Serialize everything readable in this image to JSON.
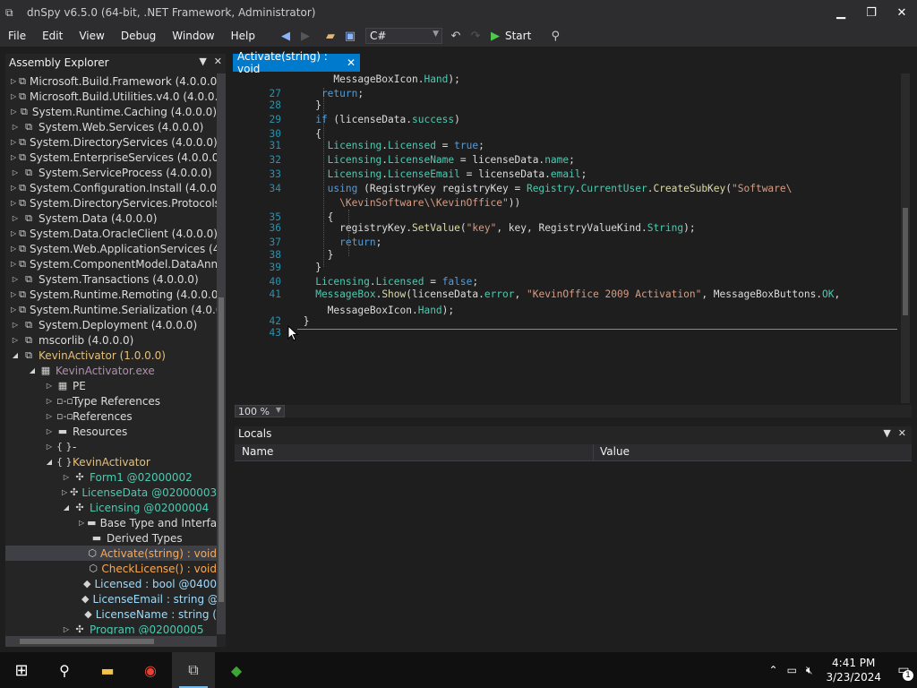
{
  "window": {
    "title": "dnSpy v6.5.0 (64-bit, .NET Framework, Administrator)"
  },
  "menu": [
    "File",
    "Edit",
    "View",
    "Debug",
    "Window",
    "Help"
  ],
  "toolbar": {
    "language": "C#",
    "start_label": "Start"
  },
  "explorer": {
    "title": "Assembly Explorer",
    "items": [
      {
        "label": "Microsoft.Build.Framework (4.0.0.0)",
        "indent": 0,
        "exp": "▷",
        "icon": "⧉",
        "color": "c-white"
      },
      {
        "label": "Microsoft.Build.Utilities.v4.0 (4.0.0.0)",
        "indent": 0,
        "exp": "▷",
        "icon": "⧉",
        "color": "c-white"
      },
      {
        "label": "System.Runtime.Caching (4.0.0.0)",
        "indent": 0,
        "exp": "▷",
        "icon": "⧉",
        "color": "c-white"
      },
      {
        "label": "System.Web.Services (4.0.0.0)",
        "indent": 0,
        "exp": "▷",
        "icon": "⧉",
        "color": "c-white"
      },
      {
        "label": "System.DirectoryServices (4.0.0.0)",
        "indent": 0,
        "exp": "▷",
        "icon": "⧉",
        "color": "c-white"
      },
      {
        "label": "System.EnterpriseServices (4.0.0.0)",
        "indent": 0,
        "exp": "▷",
        "icon": "⧉",
        "color": "c-white"
      },
      {
        "label": "System.ServiceProcess (4.0.0.0)",
        "indent": 0,
        "exp": "▷",
        "icon": "⧉",
        "color": "c-white"
      },
      {
        "label": "System.Configuration.Install (4.0.0.0)",
        "indent": 0,
        "exp": "▷",
        "icon": "⧉",
        "color": "c-white"
      },
      {
        "label": "System.DirectoryServices.Protocols (",
        "indent": 0,
        "exp": "▷",
        "icon": "⧉",
        "color": "c-white"
      },
      {
        "label": "System.Data (4.0.0.0)",
        "indent": 0,
        "exp": "▷",
        "icon": "⧉",
        "color": "c-white"
      },
      {
        "label": "System.Data.OracleClient (4.0.0.0)",
        "indent": 0,
        "exp": "▷",
        "icon": "⧉",
        "color": "c-white"
      },
      {
        "label": "System.Web.ApplicationServices (4.0",
        "indent": 0,
        "exp": "▷",
        "icon": "⧉",
        "color": "c-white"
      },
      {
        "label": "System.ComponentModel.DataAnno",
        "indent": 0,
        "exp": "▷",
        "icon": "⧉",
        "color": "c-white"
      },
      {
        "label": "System.Transactions (4.0.0.0)",
        "indent": 0,
        "exp": "▷",
        "icon": "⧉",
        "color": "c-white"
      },
      {
        "label": "System.Runtime.Remoting (4.0.0.0)",
        "indent": 0,
        "exp": "▷",
        "icon": "⧉",
        "color": "c-white"
      },
      {
        "label": "System.Runtime.Serialization (4.0.0.0",
        "indent": 0,
        "exp": "▷",
        "icon": "⧉",
        "color": "c-white"
      },
      {
        "label": "System.Deployment (4.0.0.0)",
        "indent": 0,
        "exp": "▷",
        "icon": "⧉",
        "color": "c-white"
      },
      {
        "label": "mscorlib (4.0.0.0)",
        "indent": 0,
        "exp": "▷",
        "icon": "⧉",
        "color": "c-white"
      },
      {
        "label": "KevinActivator (1.0.0.0)",
        "indent": 0,
        "exp": "◢",
        "icon": "⧉",
        "color": "c-yellow"
      },
      {
        "label": "KevinActivator.exe",
        "indent": 1,
        "exp": "◢",
        "icon": "▦",
        "color": "c-purple"
      },
      {
        "label": "PE",
        "indent": 2,
        "exp": "▷",
        "icon": "▦",
        "color": "c-white"
      },
      {
        "label": "Type References",
        "indent": 2,
        "exp": "▷",
        "icon": "▫-▫",
        "color": "c-white"
      },
      {
        "label": "References",
        "indent": 2,
        "exp": "▷",
        "icon": "▫-▫",
        "color": "c-white"
      },
      {
        "label": "Resources",
        "indent": 2,
        "exp": "▷",
        "icon": "▬",
        "color": "c-white"
      },
      {
        "label": "-",
        "indent": 2,
        "exp": "▷",
        "icon": "{ }",
        "color": "c-white"
      },
      {
        "label": "KevinActivator",
        "indent": 2,
        "exp": "◢",
        "icon": "{ }",
        "color": "c-yellow"
      },
      {
        "label": "Form1 @02000002",
        "indent": 3,
        "exp": "▷",
        "icon": "✣",
        "color": "c-green"
      },
      {
        "label": "LicenseData @02000003",
        "indent": 3,
        "exp": "▷",
        "icon": "✣",
        "color": "c-green"
      },
      {
        "label": "Licensing @02000004",
        "indent": 3,
        "exp": "◢",
        "icon": "✣",
        "color": "c-green"
      },
      {
        "label": "Base Type and Interfac",
        "indent": 4,
        "exp": "▷",
        "icon": "▬",
        "color": "c-white"
      },
      {
        "label": "Derived Types",
        "indent": 4,
        "exp": "",
        "icon": "▬",
        "color": "c-white"
      },
      {
        "label": "Activate(string) : void",
        "indent": 4,
        "exp": "",
        "icon": "⬡",
        "color": "c-orange",
        "selected": true
      },
      {
        "label": "CheckLicense() : void",
        "indent": 4,
        "exp": "",
        "icon": "⬡",
        "color": "c-orange"
      },
      {
        "label": "Licensed : bool @0400",
        "indent": 4,
        "exp": "",
        "icon": "◆",
        "color": "c-light"
      },
      {
        "label": "LicenseEmail : string @",
        "indent": 4,
        "exp": "",
        "icon": "◆",
        "color": "c-light"
      },
      {
        "label": "LicenseName : string (",
        "indent": 4,
        "exp": "",
        "icon": "◆",
        "color": "c-light"
      },
      {
        "label": "Program @02000005",
        "indent": 3,
        "exp": "▷",
        "icon": "✣",
        "color": "c-green"
      }
    ]
  },
  "editor": {
    "tab_label": "Activate(string) : void",
    "zoom": "100 %",
    "lines": [
      {
        "n": "",
        "segs": [
          [
            "      MessageBoxIcon.",
            "#dcdcdc"
          ],
          [
            "Hand",
            "#4ec9b0"
          ],
          [
            ");",
            "#dcdcdc"
          ]
        ]
      },
      {
        "n": "27",
        "segs": [
          [
            "    return",
            "#569cd6"
          ],
          [
            ";",
            "#dcdcdc"
          ]
        ]
      },
      {
        "n": "28",
        "segs": [
          [
            "   }",
            "#dcdcdc"
          ]
        ]
      },
      {
        "n": "29",
        "segs": [
          [
            "   if",
            "#569cd6"
          ],
          [
            " (licenseData.",
            "#dcdcdc"
          ],
          [
            "success",
            "#4ec9b0"
          ],
          [
            ")",
            "#dcdcdc"
          ]
        ]
      },
      {
        "n": "30",
        "segs": [
          [
            "   {",
            "#dcdcdc"
          ]
        ]
      },
      {
        "n": "31",
        "segs": [
          [
            "     Licensing",
            "#4ec9b0"
          ],
          [
            ".",
            "#dcdcdc"
          ],
          [
            "Licensed",
            "#4ec9b0"
          ],
          [
            " = ",
            "#dcdcdc"
          ],
          [
            "true",
            "#569cd6"
          ],
          [
            ";",
            "#dcdcdc"
          ]
        ]
      },
      {
        "n": "32",
        "segs": [
          [
            "     Licensing",
            "#4ec9b0"
          ],
          [
            ".",
            "#dcdcdc"
          ],
          [
            "LicenseName",
            "#4ec9b0"
          ],
          [
            " = licenseData.",
            "#dcdcdc"
          ],
          [
            "name",
            "#4ec9b0"
          ],
          [
            ";",
            "#dcdcdc"
          ]
        ]
      },
      {
        "n": "33",
        "segs": [
          [
            "     Licensing",
            "#4ec9b0"
          ],
          [
            ".",
            "#dcdcdc"
          ],
          [
            "LicenseEmail",
            "#4ec9b0"
          ],
          [
            " = licenseData.",
            "#dcdcdc"
          ],
          [
            "email",
            "#4ec9b0"
          ],
          [
            ";",
            "#dcdcdc"
          ]
        ]
      },
      {
        "n": "34",
        "segs": [
          [
            "     using",
            "#569cd6"
          ],
          [
            " (RegistryKey registryKey = ",
            "#dcdcdc"
          ],
          [
            "Registry",
            "#4ec9b0"
          ],
          [
            ".",
            "#dcdcdc"
          ],
          [
            "CurrentUser",
            "#4ec9b0"
          ],
          [
            ".",
            "#dcdcdc"
          ],
          [
            "CreateSubKey",
            "#dcdcaa"
          ],
          [
            "(",
            "#dcdcdc"
          ],
          [
            "\"Software\\",
            "#d69d85"
          ]
        ]
      },
      {
        "n": "",
        "segs": [
          [
            "       \\KevinSoftware\\\\KevinOffice\"",
            "#d69d85"
          ],
          [
            "))",
            "#dcdcdc"
          ]
        ]
      },
      {
        "n": "35",
        "segs": [
          [
            "     {",
            "#dcdcdc"
          ]
        ]
      },
      {
        "n": "36",
        "segs": [
          [
            "       registryKey.",
            "#dcdcdc"
          ],
          [
            "SetValue",
            "#dcdcaa"
          ],
          [
            "(",
            "#dcdcdc"
          ],
          [
            "\"key\"",
            "#d69d85"
          ],
          [
            ", key, RegistryValueKind.",
            "#dcdcdc"
          ],
          [
            "String",
            "#4ec9b0"
          ],
          [
            ");",
            "#dcdcdc"
          ]
        ]
      },
      {
        "n": "37",
        "segs": [
          [
            "       return",
            "#569cd6"
          ],
          [
            ";",
            "#dcdcdc"
          ]
        ]
      },
      {
        "n": "38",
        "segs": [
          [
            "     }",
            "#dcdcdc"
          ]
        ]
      },
      {
        "n": "39",
        "segs": [
          [
            "   }",
            "#dcdcdc"
          ]
        ]
      },
      {
        "n": "40",
        "segs": [
          [
            "   Licensing",
            "#4ec9b0"
          ],
          [
            ".",
            "#dcdcdc"
          ],
          [
            "Licensed",
            "#4ec9b0"
          ],
          [
            " = ",
            "#dcdcdc"
          ],
          [
            "false",
            "#569cd6"
          ],
          [
            ";",
            "#dcdcdc"
          ]
        ]
      },
      {
        "n": "41",
        "segs": [
          [
            "   MessageBox",
            "#4ec9b0"
          ],
          [
            ".",
            "#dcdcdc"
          ],
          [
            "Show",
            "#dcdcaa"
          ],
          [
            "(licenseData.",
            "#dcdcdc"
          ],
          [
            "error",
            "#4ec9b0"
          ],
          [
            ", ",
            "#dcdcdc"
          ],
          [
            "\"KevinOffice 2009 Activation\"",
            "#d69d85"
          ],
          [
            ", MessageBoxButtons.",
            "#dcdcdc"
          ],
          [
            "OK",
            "#4ec9b0"
          ],
          [
            ",",
            "#dcdcdc"
          ]
        ]
      },
      {
        "n": "",
        "segs": [
          [
            "     MessageBoxIcon.",
            "#dcdcdc"
          ],
          [
            "Hand",
            "#4ec9b0"
          ],
          [
            ");",
            "#dcdcdc"
          ]
        ]
      },
      {
        "n": "42",
        "segs": [
          [
            " }",
            "#dcdcdc"
          ]
        ]
      },
      {
        "n": "43",
        "segs": [
          [
            "",
            "#dcdcdc"
          ]
        ]
      }
    ]
  },
  "locals": {
    "title": "Locals",
    "col_name": "Name",
    "col_value": "Value"
  },
  "taskbar": {
    "time": "4:41 PM",
    "date": "3/23/2024",
    "notifications": "1"
  }
}
